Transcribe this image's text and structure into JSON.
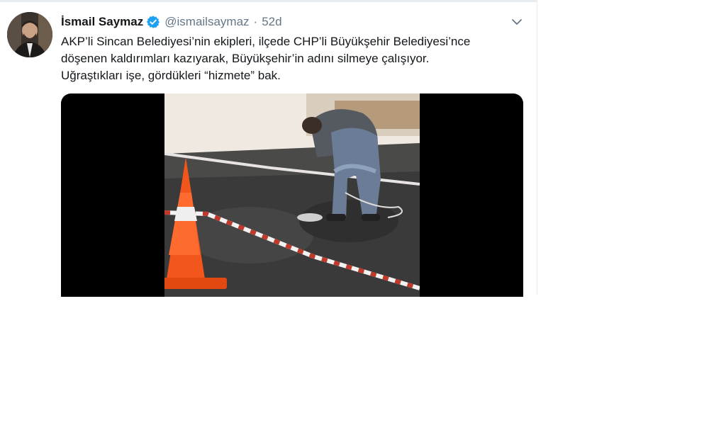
{
  "tweet": {
    "author_name": "İsmail Saymaz",
    "handle": "@ismailsaymaz",
    "separator": "·",
    "time": "52d",
    "text_lines": [
      "AKP’li Sincan Belediyesi’nin ekipleri, ilçede CHP’li Büyükşehir Belediyesi’nce",
      "döşenen kaldırımları kazıyarak, Büyükşehir’in adını silmeye çalışıyor.",
      "Uğraştıkları işe, gördükleri “hizmete” bak."
    ],
    "verified_icon": "verified-badge-icon",
    "menu_icon": "chevron-down-icon",
    "media": {
      "type": "video",
      "description_icon": "video-thumbnail"
    }
  },
  "colors": {
    "name": "#14171a",
    "muted": "#657786",
    "verified": "#1da1f2",
    "divider": "#e6ecf0"
  }
}
